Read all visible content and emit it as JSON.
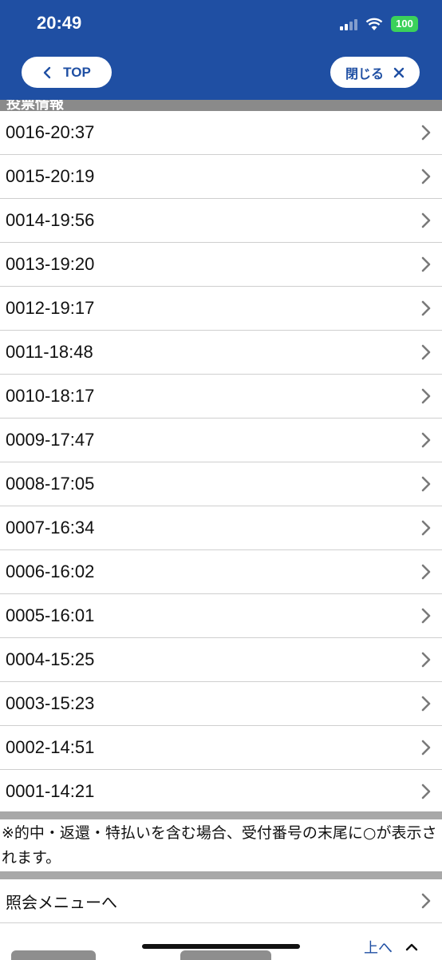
{
  "status_bar": {
    "time": "20:49",
    "battery": "100"
  },
  "header": {
    "back_label": "TOP",
    "close_label": "閉じる"
  },
  "section": {
    "title": "投票情報"
  },
  "entries": [
    "0016-20:37",
    "0015-20:19",
    "0014-19:56",
    "0013-19:20",
    "0012-19:17",
    "0011-18:48",
    "0010-18:17",
    "0009-17:47",
    "0008-17:05",
    "0007-16:34",
    "0006-16:02",
    "0005-16:01",
    "0004-15:25",
    "0003-15:23",
    "0002-14:51",
    "0001-14:21"
  ],
  "note": "※的中・返還・特払いを含む場合、受付番号の末尾に○が表示されます。",
  "menu_link": "照会メニューへ",
  "footer": {
    "up_label": "上へ"
  },
  "colors": {
    "header": "#1f4fa3",
    "separator": "#a8a8a8",
    "battery": "#3bd15a"
  }
}
